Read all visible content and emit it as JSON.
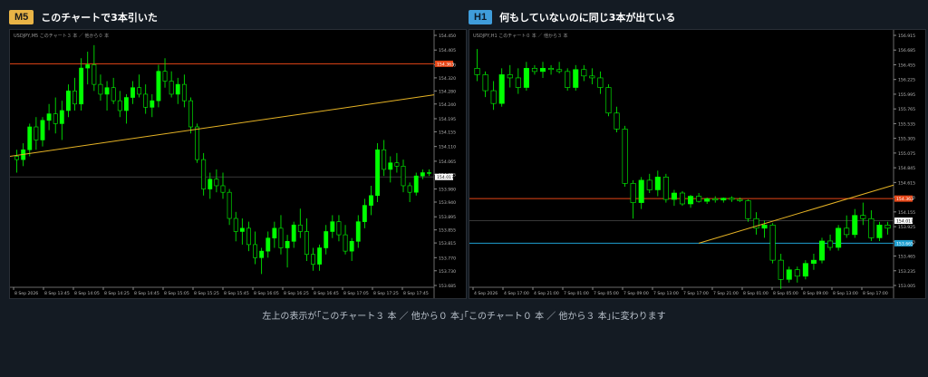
{
  "caption": "左上の表示が｢このチャート３ 本 ／ 他から０ 本｣｢このチャート０ 本 ／ 他から３ 本｣に変わります",
  "colors": {
    "bull": "#00ff00",
    "bear": "#000000",
    "red_line": "#e64617",
    "blue_line": "#1e9fd0",
    "trend": "#e6b325",
    "grid": "#1d2227",
    "axis_text": "#b8b8b8"
  },
  "panels": [
    {
      "badge": "M5",
      "title": "このチャートで3本引いた",
      "chart_info": "USDJPY,M5  このチャート３ 本 ／ 他から０ 本",
      "price_ticks": [
        "154.450",
        "154.405",
        "154.360",
        "154.320",
        "154.280",
        "154.240",
        "154.195",
        "154.155",
        "154.110",
        "154.065",
        "154.025",
        "153.980",
        "153.940",
        "153.895",
        "153.855",
        "153.815",
        "153.770",
        "153.730",
        "153.685"
      ],
      "time_ticks": [
        "8 Sep 2026",
        "8 Sep 13:45",
        "8 Sep 14:05",
        "8 Sep 14:25",
        "8 Sep 14:45",
        "8 Sep 15:05",
        "8 Sep 15:25",
        "8 Sep 15:45",
        "8 Sep 16:05",
        "8 Sep 16:25",
        "8 Sep 16:45",
        "8 Sep 17:05",
        "8 Sep 17:25",
        "8 Sep 17:45"
      ],
      "level_label": "154.363",
      "current_label": "154.017",
      "ohlc": [
        [
          154.08,
          154.1,
          154.03,
          154.07
        ],
        [
          154.07,
          154.12,
          154.05,
          154.1
        ],
        [
          154.1,
          154.18,
          154.08,
          154.17
        ],
        [
          154.17,
          154.2,
          154.1,
          154.13
        ],
        [
          154.13,
          154.2,
          154.11,
          154.19
        ],
        [
          154.19,
          154.24,
          154.16,
          154.21
        ],
        [
          154.21,
          154.26,
          154.15,
          154.18
        ],
        [
          154.18,
          154.25,
          154.13,
          154.22
        ],
        [
          154.22,
          154.3,
          154.2,
          154.28
        ],
        [
          154.28,
          154.32,
          154.22,
          154.24
        ],
        [
          154.24,
          154.38,
          154.22,
          154.35
        ],
        [
          154.35,
          154.4,
          154.3,
          154.36
        ],
        [
          154.36,
          154.42,
          154.28,
          154.3
        ],
        [
          154.3,
          154.33,
          154.25,
          154.27
        ],
        [
          154.27,
          154.31,
          154.22,
          154.29
        ],
        [
          154.29,
          154.32,
          154.24,
          154.25
        ],
        [
          154.25,
          154.28,
          154.2,
          154.22
        ],
        [
          154.22,
          154.27,
          154.18,
          154.26
        ],
        [
          154.26,
          154.31,
          154.24,
          154.29
        ],
        [
          154.29,
          154.33,
          154.26,
          154.27
        ],
        [
          154.27,
          154.3,
          154.21,
          154.23
        ],
        [
          154.23,
          154.27,
          154.2,
          154.25
        ],
        [
          154.25,
          154.36,
          154.23,
          154.34
        ],
        [
          154.34,
          154.38,
          154.29,
          154.31
        ],
        [
          154.31,
          154.34,
          154.26,
          154.27
        ],
        [
          154.27,
          154.32,
          154.24,
          154.3
        ],
        [
          154.3,
          154.33,
          154.23,
          154.25
        ],
        [
          154.25,
          154.26,
          154.15,
          154.17
        ],
        [
          154.17,
          154.18,
          154.06,
          154.07
        ],
        [
          154.07,
          154.09,
          153.96,
          153.98
        ],
        [
          153.98,
          154.03,
          153.95,
          154.01
        ],
        [
          154.01,
          154.04,
          153.97,
          153.99
        ],
        [
          153.99,
          154.03,
          153.95,
          153.97
        ],
        [
          153.97,
          153.98,
          153.87,
          153.89
        ],
        [
          153.89,
          153.91,
          153.82,
          153.85
        ],
        [
          153.85,
          153.89,
          153.81,
          153.86
        ],
        [
          153.86,
          153.88,
          153.79,
          153.81
        ],
        [
          153.81,
          153.85,
          153.75,
          153.77
        ],
        [
          153.77,
          153.8,
          153.72,
          153.79
        ],
        [
          153.79,
          153.85,
          153.77,
          153.83
        ],
        [
          153.83,
          153.88,
          153.8,
          153.86
        ],
        [
          153.86,
          153.9,
          153.78,
          153.8
        ],
        [
          153.8,
          153.84,
          153.74,
          153.82
        ],
        [
          153.82,
          153.88,
          153.8,
          153.87
        ],
        [
          153.87,
          153.92,
          153.83,
          153.85
        ],
        [
          153.85,
          153.89,
          153.76,
          153.78
        ],
        [
          153.78,
          153.8,
          153.73,
          153.75
        ],
        [
          153.75,
          153.81,
          153.73,
          153.8
        ],
        [
          153.8,
          153.87,
          153.78,
          153.85
        ],
        [
          153.85,
          153.9,
          153.83,
          153.88
        ],
        [
          153.88,
          153.9,
          153.82,
          153.84
        ],
        [
          153.84,
          153.87,
          153.78,
          153.79
        ],
        [
          153.79,
          153.83,
          153.76,
          153.82
        ],
        [
          153.82,
          153.9,
          153.8,
          153.88
        ],
        [
          153.88,
          153.95,
          153.86,
          153.93
        ],
        [
          153.93,
          153.99,
          153.9,
          153.96
        ],
        [
          153.96,
          154.12,
          153.94,
          154.1
        ],
        [
          154.1,
          154.13,
          154.02,
          154.04
        ],
        [
          154.04,
          154.08,
          154.0,
          154.06
        ],
        [
          154.06,
          154.09,
          154.03,
          154.05
        ],
        [
          154.05,
          154.07,
          153.97,
          153.99
        ],
        [
          153.99,
          154.0,
          153.94,
          153.97
        ],
        [
          153.97,
          154.03,
          153.96,
          154.02
        ],
        [
          154.02,
          154.04,
          154.01,
          154.03
        ],
        [
          154.03,
          154.04,
          154.02,
          154.03
        ]
      ],
      "levels": [
        154.363
      ],
      "trend": [
        [
          0,
          154.08
        ],
        [
          78,
          154.268
        ]
      ]
    },
    {
      "badge": "H1",
      "title": "何もしていないのに同じ3本が出ている",
      "chart_info": "USDJPY,H1  このチャート０ 本 ／ 他から３ 本",
      "price_ticks": [
        "156.915",
        "156.685",
        "156.455",
        "156.225",
        "155.995",
        "155.765",
        "155.535",
        "155.305",
        "155.075",
        "154.845",
        "154.615",
        "154.385",
        "154.155",
        "153.925",
        "153.695",
        "153.465",
        "153.235",
        "153.005"
      ],
      "time_ticks": [
        "4 Sep 2026",
        "4 Sep 17:00",
        "4 Sep 21:00",
        "7 Sep 01:00",
        "7 Sep 05:00",
        "7 Sep 09:00",
        "7 Sep 13:00",
        "7 Sep 17:00",
        "7 Sep 21:00",
        "8 Sep 01:00",
        "8 Sep 05:00",
        "8 Sep 09:00",
        "8 Sep 13:00",
        "8 Sep 17:00"
      ],
      "level_label": "154.363",
      "current_label": "154.017",
      "blue_label": "153.665",
      "ohlc": [
        [
          156.4,
          156.7,
          156.2,
          156.3
        ],
        [
          156.3,
          156.35,
          155.95,
          156.05
        ],
        [
          156.05,
          156.2,
          155.75,
          155.85
        ],
        [
          155.85,
          156.4,
          155.8,
          156.3
        ],
        [
          156.3,
          156.45,
          156.1,
          156.25
        ],
        [
          156.25,
          156.4,
          156.0,
          156.1
        ],
        [
          156.1,
          156.5,
          156.05,
          156.4
        ],
        [
          156.4,
          156.45,
          156.3,
          156.35
        ],
        [
          156.35,
          156.5,
          156.25,
          156.4
        ],
        [
          156.4,
          156.45,
          156.3,
          156.38
        ],
        [
          156.38,
          156.5,
          156.32,
          156.35
        ],
        [
          156.35,
          156.4,
          156.05,
          156.1
        ],
        [
          156.1,
          156.45,
          156.05,
          156.38
        ],
        [
          156.38,
          156.45,
          156.2,
          156.28
        ],
        [
          156.28,
          156.4,
          156.15,
          156.25
        ],
        [
          156.25,
          156.35,
          156.0,
          156.1
        ],
        [
          156.1,
          156.15,
          155.65,
          155.7
        ],
        [
          155.7,
          155.8,
          155.4,
          155.45
        ],
        [
          155.45,
          155.5,
          154.55,
          154.6
        ],
        [
          154.6,
          154.65,
          154.05,
          154.3
        ],
        [
          154.3,
          154.7,
          154.2,
          154.65
        ],
        [
          154.65,
          154.75,
          154.45,
          154.5
        ],
        [
          154.5,
          154.8,
          154.4,
          154.7
        ],
        [
          154.7,
          154.75,
          154.3,
          154.35
        ],
        [
          154.35,
          154.5,
          154.25,
          154.45
        ],
        [
          154.45,
          154.48,
          154.25,
          154.28
        ],
        [
          154.28,
          154.42,
          154.22,
          154.4
        ],
        [
          154.4,
          154.45,
          154.3,
          154.32
        ],
        [
          154.32,
          154.38,
          154.28,
          154.36
        ],
        [
          154.36,
          154.4,
          154.3,
          154.34
        ],
        [
          154.34,
          154.38,
          154.3,
          154.37
        ],
        [
          154.37,
          154.4,
          154.31,
          154.35
        ],
        [
          154.35,
          154.38,
          154.31,
          154.33
        ],
        [
          154.33,
          154.35,
          154.0,
          154.05
        ],
        [
          154.05,
          154.15,
          153.8,
          153.9
        ],
        [
          153.9,
          154.02,
          153.75,
          153.95
        ],
        [
          153.95,
          153.98,
          153.35,
          153.4
        ],
        [
          153.4,
          153.5,
          152.95,
          153.1
        ],
        [
          153.1,
          153.3,
          153.05,
          153.25
        ],
        [
          153.25,
          153.3,
          153.05,
          153.15
        ],
        [
          153.15,
          153.4,
          153.1,
          153.35
        ],
        [
          153.35,
          153.5,
          153.25,
          153.4
        ],
        [
          153.4,
          153.75,
          153.35,
          153.7
        ],
        [
          153.7,
          153.8,
          153.55,
          153.6
        ],
        [
          153.6,
          153.95,
          153.55,
          153.9
        ],
        [
          153.9,
          154.1,
          153.75,
          153.8
        ],
        [
          153.8,
          154.2,
          153.75,
          154.1
        ],
        [
          154.1,
          154.3,
          153.95,
          154.05
        ],
        [
          154.05,
          154.18,
          153.7,
          153.75
        ],
        [
          153.75,
          154.0,
          153.7,
          153.95
        ],
        [
          153.95,
          154.0,
          153.8,
          153.9
        ]
      ],
      "levels_red": [
        154.363
      ],
      "levels_blue": [
        153.665
      ],
      "trend": [
        [
          27,
          153.665
        ],
        [
          54,
          154.7
        ]
      ]
    }
  ]
}
